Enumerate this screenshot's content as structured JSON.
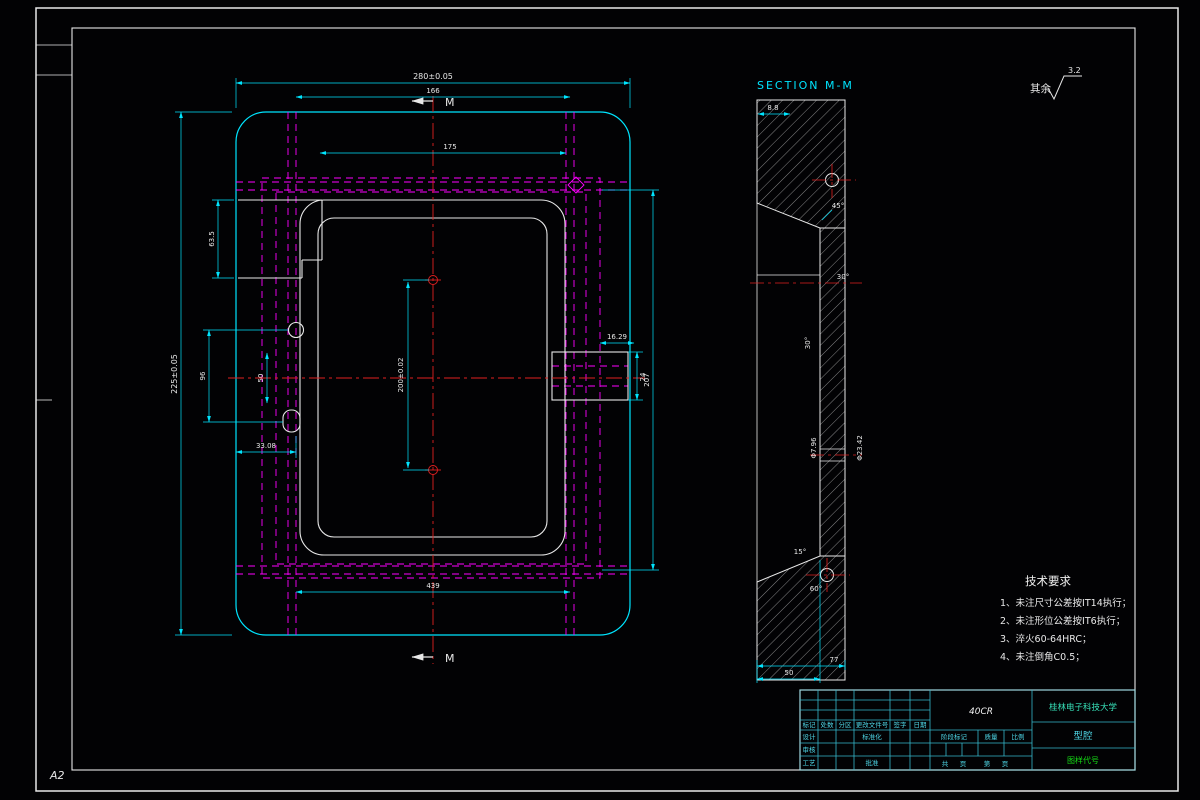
{
  "sheet": {
    "format": "A2"
  },
  "roughness": {
    "prefix": "其余",
    "value": "3.2"
  },
  "plan": {
    "cut_label_top": "M",
    "cut_label_bottom": "M",
    "dims": {
      "overall_width": "280±0.05",
      "inner_width_166": "166",
      "cavity_width_175": "175",
      "overall_height": "225±0.05",
      "step_height_63_5": "63.5",
      "feature_pitch_96": "96",
      "slot_height_50": "50",
      "offset_33_08": "33.08",
      "target_span_200": "200±0.02",
      "tab_offset_16_29": "16.29",
      "tab_height_24": "24",
      "right_height_207": "207",
      "bottom_width_439": "439"
    }
  },
  "section": {
    "title": "SECTION M-M",
    "dims": {
      "top_8_8": "8.8",
      "angle_45": "45°",
      "angle_30": "30°",
      "angle_30_side": "30°",
      "hole_dia": "Φ7.96",
      "counterbore_dia": "Φ23.42",
      "angle_15": "15°",
      "angle_60": "60°",
      "width_77": "77",
      "width_50": "50"
    }
  },
  "tech": {
    "title": "技术要求",
    "items": [
      "1、未注尺寸公差按IT14执行；",
      "2、未注形位公差按IT6执行；",
      "3、淬火60-64HRC；",
      "4、未注倒角C0.5；"
    ]
  },
  "titleblock": {
    "material": "40CR",
    "company": "桂林电子科技大学",
    "part_name": "型腔",
    "drawing_code": "图样代号",
    "labels": {
      "mark": "标记",
      "count": "处数",
      "zone": "分区",
      "change_doc": "更改文件号",
      "sign": "签字",
      "date": "日期",
      "design": "设计",
      "standardize": "标准化",
      "check": "审核",
      "process": "工艺",
      "approve": "批准",
      "stage_mark": "阶段标记",
      "weight": "质量",
      "scale": "比例",
      "total": "共",
      "page1": "页",
      "sheet_no": "第",
      "page2": "页"
    }
  }
}
